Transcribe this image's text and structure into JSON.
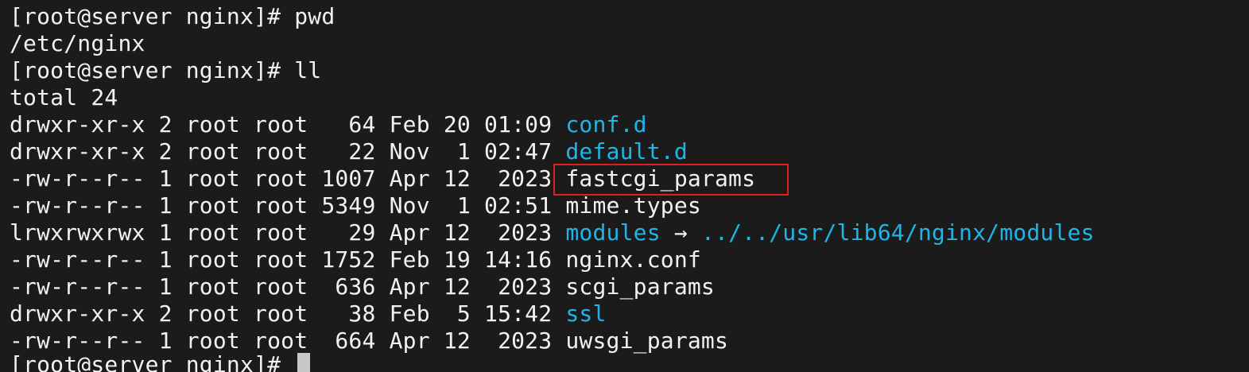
{
  "terminal": {
    "partial_top_line": "                                  ",
    "prompt": "[root@server nginx]# ",
    "commands": [
      "pwd",
      "ll"
    ],
    "pwd_output": "/etc/nginx",
    "total_line": "total 24",
    "colors": {
      "background": "#1b1b1b",
      "text": "#f2f2f2",
      "directory": "#1fb5e8",
      "highlight": "#e02020"
    },
    "entries": [
      {
        "meta": "drwxr-xr-x 2 root root   64 Feb 20 01:09 ",
        "name": "conf.d",
        "kind": "dir",
        "target": ""
      },
      {
        "meta": "drwxr-xr-x 2 root root   22 Nov  1 02:47 ",
        "name": "default.d",
        "kind": "dir",
        "target": ""
      },
      {
        "meta": "-rw-r--r-- 1 root root 1007 Apr 12  2023 ",
        "name": "fastcgi_params",
        "kind": "file",
        "target": ""
      },
      {
        "meta": "-rw-r--r-- 1 root root 5349 Nov  1 02:51 ",
        "name": "mime.types",
        "kind": "file",
        "target": ""
      },
      {
        "meta": "lrwxrwxrwx 1 root root   29 Apr 12  2023 ",
        "name": "modules",
        "kind": "link",
        "arrow": " → ",
        "target": "../../usr/lib64/nginx/modules"
      },
      {
        "meta": "-rw-r--r-- 1 root root 1752 Feb 19 14:16 ",
        "name": "nginx.conf",
        "kind": "file",
        "target": ""
      },
      {
        "meta": "-rw-r--r-- 1 root root  636 Apr 12  2023 ",
        "name": "scgi_params",
        "kind": "file",
        "target": ""
      },
      {
        "meta": "drwxr-xr-x 2 root root   38 Feb  5 15:42 ",
        "name": "ssl",
        "kind": "dir",
        "target": ""
      },
      {
        "meta": "-rw-r--r-- 1 root root  664 Apr 12  2023 ",
        "name": "uwsgi_params",
        "kind": "file",
        "target": ""
      }
    ]
  }
}
